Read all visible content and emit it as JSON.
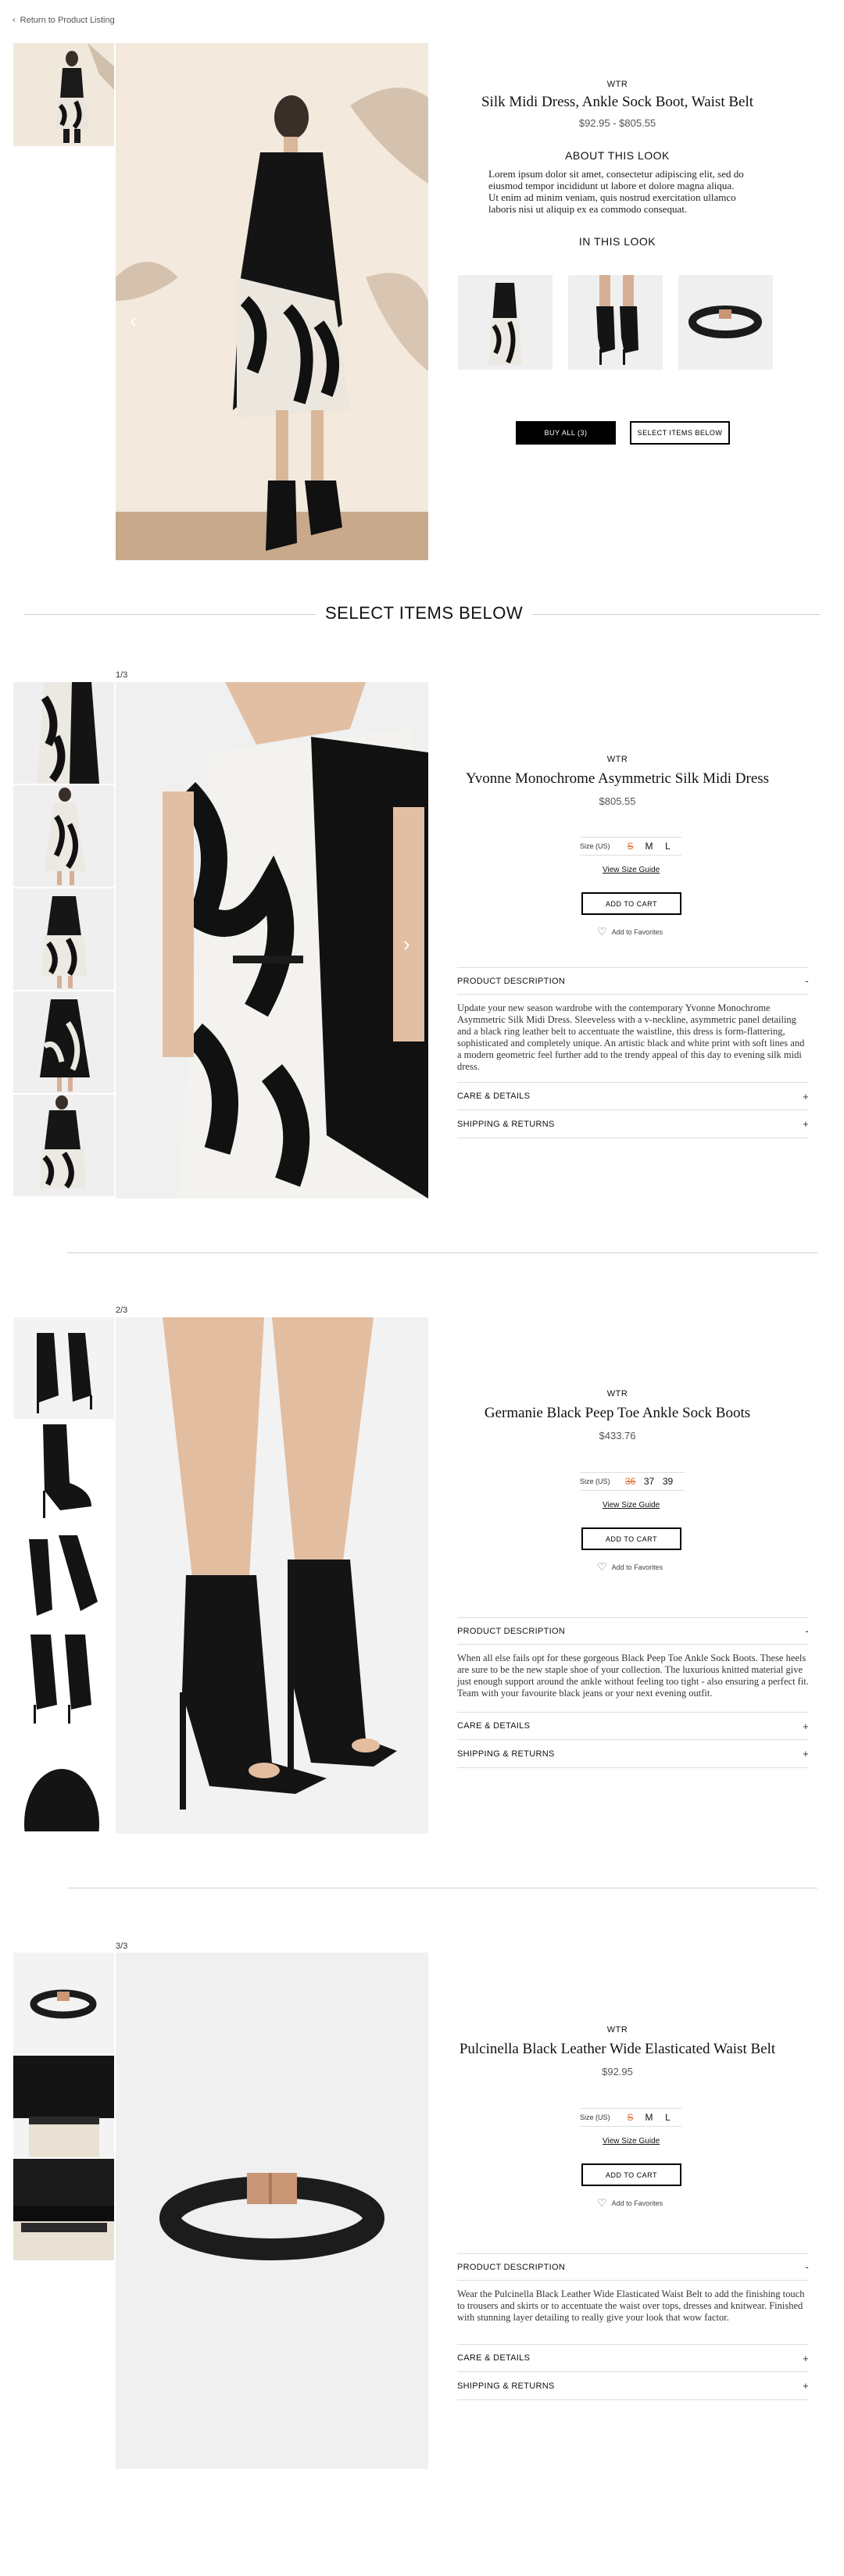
{
  "nav": {
    "back_label": "Return to Product Listing"
  },
  "look": {
    "brand": "WTR",
    "title": "Silk Midi Dress, Ankle Sock Boot, Waist Belt",
    "price": "$92.95 - $805.55",
    "about_heading": "ABOUT THIS LOOK",
    "about_text": "Lorem ipsum dolor sit amet, consectetur adipiscing elit, sed do eiusmod tempor incididunt ut labore et dolore magna aliqua. Ut enim ad minim veniam, quis nostrud exercitation ullamco laboris nisi ut aliquip ex ea commodo consequat.",
    "in_look_heading": "IN THIS LOOK",
    "buy_all_label": "BUY ALL (3)",
    "select_below_label": "SELECT ITEMS BELOW"
  },
  "select_heading": "SELECT ITEMS BELOW",
  "common": {
    "size_label": "Size (US)",
    "size_guide": "View Size Guide",
    "add_to_cart": "ADD TO CART",
    "favorites": "Add to Favorites",
    "product_description": "PRODUCT DESCRIPTION",
    "care_details": "CARE & DETAILS",
    "shipping_returns": "SHIPPING & RETURNS",
    "minus": "-",
    "plus": "+"
  },
  "products": [
    {
      "counter": "1/3",
      "brand": "WTR",
      "title": "Yvonne Monochrome Asymmetric Silk Midi Dress",
      "price": "$805.55",
      "sizes": [
        "S",
        "M",
        "L"
      ],
      "selected_size": "S",
      "description": "Update your new season wardrobe with the contemporary Yvonne Monochrome Asymmetric Silk Midi Dress. Sleeveless with a v-neckline, asymmetric panel detailing and a black ring leather belt to accentuate the waistline, this dress is form-flattering, sophisticated and completely unique. An artistic black and white print with soft lines and a modern geometric feel further add to the trendy appeal of this day to evening silk midi dress."
    },
    {
      "counter": "2/3",
      "brand": "WTR",
      "title": "Germanie Black Peep Toe Ankle Sock Boots",
      "price": "$433.76",
      "sizes": [
        "36",
        "37",
        "39"
      ],
      "selected_size": "36",
      "description": "When all else fails opt for these gorgeous Black Peep Toe Ankle Sock Boots. These heels are sure to be the new staple shoe of your collection. The luxurious knitted material give just enough support around the ankle without feeling too tight - also ensuring a perfect fit. Team with your favourite black jeans or your next evening outfit."
    },
    {
      "counter": "3/3",
      "brand": "WTR",
      "title": "Pulcinella Black Leather Wide Elasticated Waist Belt",
      "price": "$92.95",
      "sizes": [
        "S",
        "M",
        "L"
      ],
      "selected_size": "S",
      "description": "Wear the Pulcinella Black Leather Wide Elasticated Waist Belt to add the finishing touch to trousers and skirts or to accentuate the waist over tops, dresses and knitwear. Finished with stunning layer detailing to really give your look that wow factor."
    }
  ],
  "icons": {
    "back": "chevron-left-icon",
    "arrow_left": "chevron-left-icon",
    "arrow_right": "chevron-right-icon",
    "favorite": "heart-icon"
  },
  "colors": {
    "accent_size": "#e06c2f",
    "button_black": "#000000",
    "divider": "#cfcfcf"
  }
}
